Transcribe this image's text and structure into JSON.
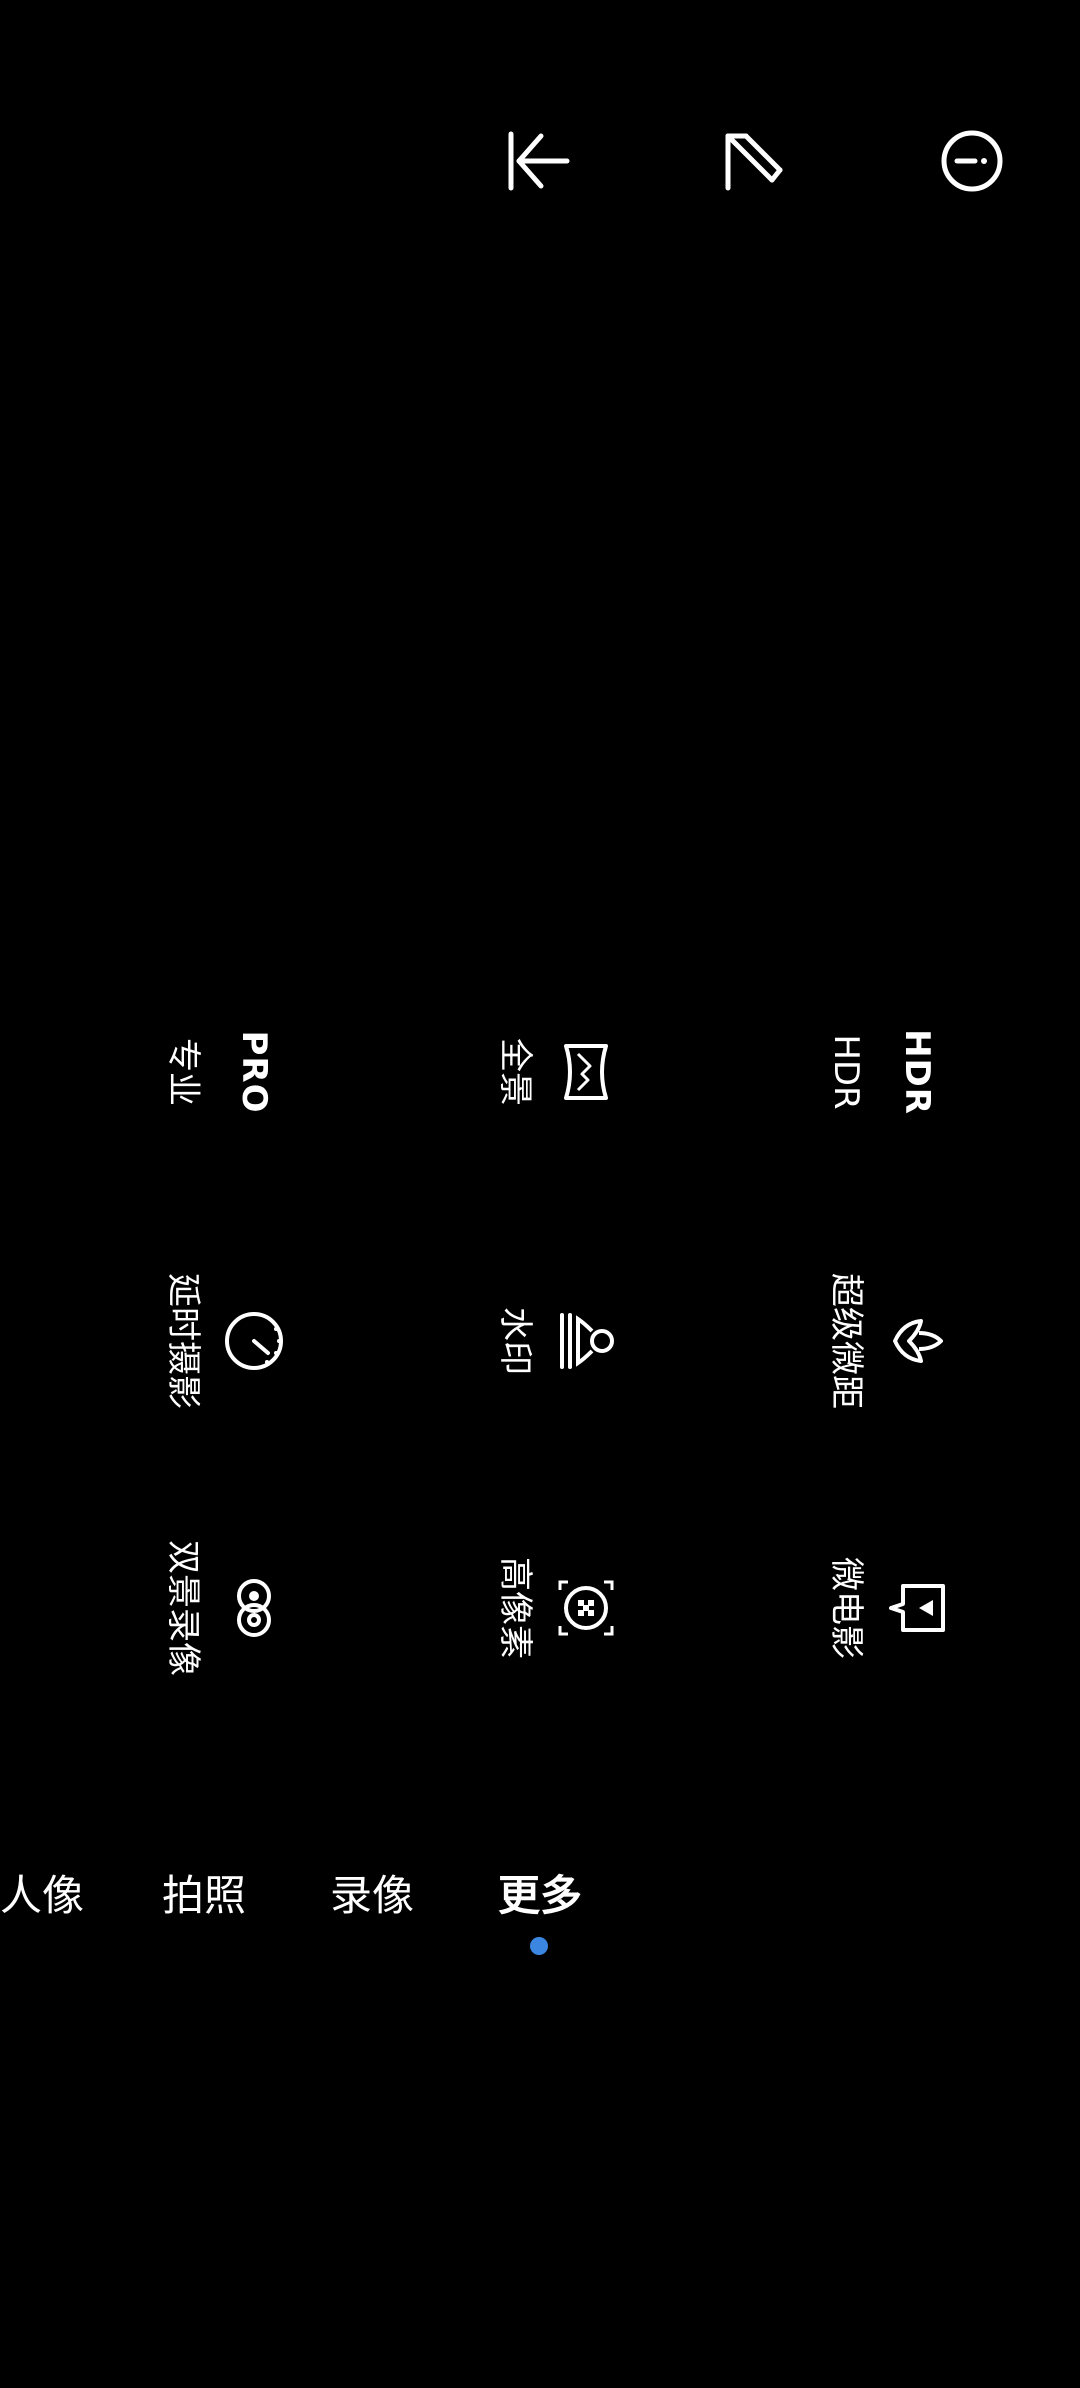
{
  "top_bar": {
    "icons": [
      {
        "name": "collapse-left-icon"
      },
      {
        "name": "edit-icon"
      },
      {
        "name": "more-icon"
      }
    ]
  },
  "modes": {
    "pro": {
      "icon_text": "PRO",
      "label": "专业"
    },
    "panorama": {
      "icon": "panorama-icon",
      "label": "全景"
    },
    "hdr": {
      "icon_text": "HDR",
      "label": "HDR"
    },
    "timelapse": {
      "icon": "timelapse-icon",
      "label": "延时摄影"
    },
    "watermark": {
      "icon": "watermark-icon",
      "label": "水印"
    },
    "super_macro": {
      "icon": "macro-flower-icon",
      "label": "超级微距"
    },
    "dual_view": {
      "icon": "dual-view-icon",
      "label": "双景录像"
    },
    "high_res": {
      "icon": "high-res-icon",
      "label": "高像素"
    },
    "micro_movie": {
      "icon": "micro-movie-icon",
      "label": "微电影"
    }
  },
  "bottom_tabs": [
    {
      "label": "人像"
    },
    {
      "label": "拍照"
    },
    {
      "label": "录像"
    },
    {
      "label": "更多",
      "active": true
    }
  ],
  "colors": {
    "background": "#000000",
    "foreground": "#ffffff",
    "accent": "#3b86e0"
  }
}
